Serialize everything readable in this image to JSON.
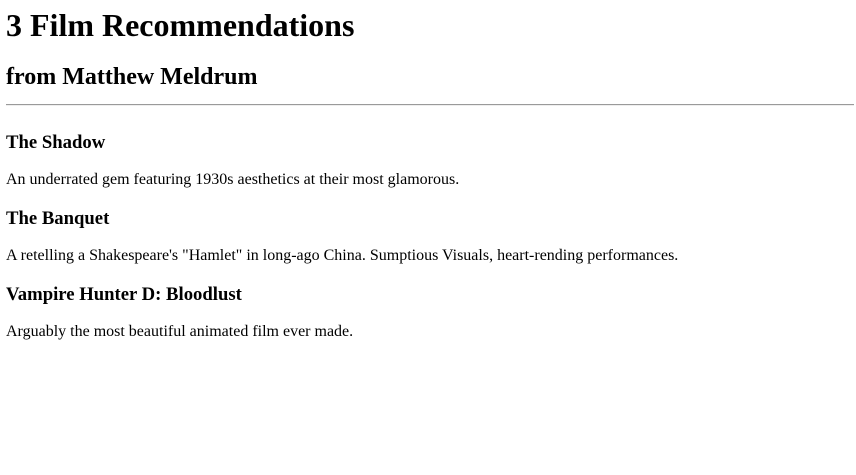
{
  "header": {
    "title": "3 Film Recommendations",
    "subtitle": "from Matthew Meldrum"
  },
  "films": [
    {
      "title": "The Shadow",
      "description": "An underrated gem featuring 1930s aesthetics at their most glamorous."
    },
    {
      "title": "The Banquet",
      "description": "A retelling a Shakespeare's \"Hamlet\" in long-ago China. Sumptious Visuals, heart-rending performances."
    },
    {
      "title": "Vampire Hunter D: Bloodlust",
      "description": "Arguably the most beautiful animated film ever made."
    }
  ]
}
